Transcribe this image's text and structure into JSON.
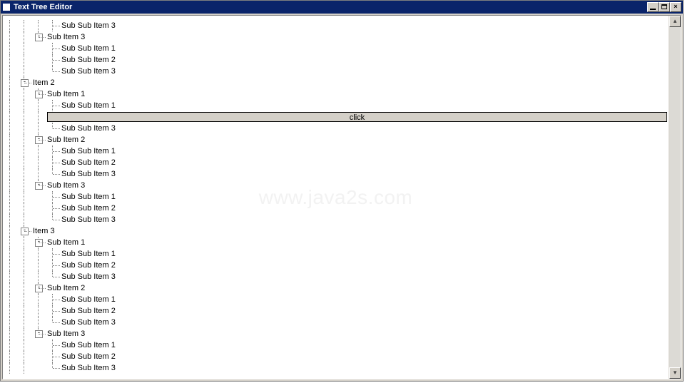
{
  "window": {
    "title": "Text Tree Editor",
    "edit_value": "click"
  },
  "watermark": "www.java2s.com",
  "rows": [
    {
      "depth": 3,
      "toggle": null,
      "label": "Sub Sub Item 3",
      "last_flags": [
        false,
        false,
        false,
        false
      ]
    },
    {
      "depth": 2,
      "toggle": "-",
      "label": "Sub Item 3",
      "last_flags": [
        false,
        false,
        true
      ]
    },
    {
      "depth": 3,
      "toggle": null,
      "label": "Sub Sub Item 1",
      "last_flags": [
        false,
        false,
        true,
        false
      ]
    },
    {
      "depth": 3,
      "toggle": null,
      "label": "Sub Sub Item 2",
      "last_flags": [
        false,
        false,
        true,
        false
      ]
    },
    {
      "depth": 3,
      "toggle": null,
      "label": "Sub Sub Item 3",
      "last_flags": [
        false,
        false,
        true,
        true
      ]
    },
    {
      "depth": 1,
      "toggle": "-",
      "label": "Item 2",
      "last_flags": [
        false,
        false
      ]
    },
    {
      "depth": 2,
      "toggle": "-",
      "label": "Sub Item 1",
      "last_flags": [
        false,
        false,
        false
      ]
    },
    {
      "depth": 3,
      "toggle": null,
      "label": "Sub Sub Item 1",
      "last_flags": [
        false,
        false,
        false,
        false
      ]
    },
    {
      "editor": true
    },
    {
      "depth": 3,
      "toggle": null,
      "label": "Sub Sub Item 3",
      "last_flags": [
        false,
        false,
        false,
        true
      ]
    },
    {
      "depth": 2,
      "toggle": "-",
      "label": "Sub Item 2",
      "last_flags": [
        false,
        false,
        false
      ]
    },
    {
      "depth": 3,
      "toggle": null,
      "label": "Sub Sub Item 1",
      "last_flags": [
        false,
        false,
        false,
        false
      ]
    },
    {
      "depth": 3,
      "toggle": null,
      "label": "Sub Sub Item 2",
      "last_flags": [
        false,
        false,
        false,
        false
      ]
    },
    {
      "depth": 3,
      "toggle": null,
      "label": "Sub Sub Item 3",
      "last_flags": [
        false,
        false,
        false,
        true
      ]
    },
    {
      "depth": 2,
      "toggle": "-",
      "label": "Sub Item 3",
      "last_flags": [
        false,
        false,
        true
      ]
    },
    {
      "depth": 3,
      "toggle": null,
      "label": "Sub Sub Item 1",
      "last_flags": [
        false,
        false,
        true,
        false
      ]
    },
    {
      "depth": 3,
      "toggle": null,
      "label": "Sub Sub Item 2",
      "last_flags": [
        false,
        false,
        true,
        false
      ]
    },
    {
      "depth": 3,
      "toggle": null,
      "label": "Sub Sub Item 3",
      "last_flags": [
        false,
        false,
        true,
        true
      ]
    },
    {
      "depth": 1,
      "toggle": "-",
      "label": "Item 3",
      "last_flags": [
        false,
        false
      ]
    },
    {
      "depth": 2,
      "toggle": "-",
      "label": "Sub Item 1",
      "last_flags": [
        false,
        false,
        false
      ]
    },
    {
      "depth": 3,
      "toggle": null,
      "label": "Sub Sub Item 1",
      "last_flags": [
        false,
        false,
        false,
        false
      ]
    },
    {
      "depth": 3,
      "toggle": null,
      "label": "Sub Sub Item 2",
      "last_flags": [
        false,
        false,
        false,
        false
      ]
    },
    {
      "depth": 3,
      "toggle": null,
      "label": "Sub Sub Item 3",
      "last_flags": [
        false,
        false,
        false,
        true
      ]
    },
    {
      "depth": 2,
      "toggle": "-",
      "label": "Sub Item 2",
      "last_flags": [
        false,
        false,
        false
      ]
    },
    {
      "depth": 3,
      "toggle": null,
      "label": "Sub Sub Item 1",
      "last_flags": [
        false,
        false,
        false,
        false
      ]
    },
    {
      "depth": 3,
      "toggle": null,
      "label": "Sub Sub Item 2",
      "last_flags": [
        false,
        false,
        false,
        false
      ]
    },
    {
      "depth": 3,
      "toggle": null,
      "label": "Sub Sub Item 3",
      "last_flags": [
        false,
        false,
        false,
        true
      ]
    },
    {
      "depth": 2,
      "toggle": "-",
      "label": "Sub Item 3",
      "last_flags": [
        false,
        false,
        true
      ]
    },
    {
      "depth": 3,
      "toggle": null,
      "label": "Sub Sub Item 1",
      "last_flags": [
        false,
        false,
        true,
        false
      ]
    },
    {
      "depth": 3,
      "toggle": null,
      "label": "Sub Sub Item 2",
      "last_flags": [
        false,
        false,
        true,
        false
      ]
    },
    {
      "depth": 3,
      "toggle": null,
      "label": "Sub Sub Item 3",
      "last_flags": [
        false,
        false,
        true,
        true
      ]
    }
  ]
}
